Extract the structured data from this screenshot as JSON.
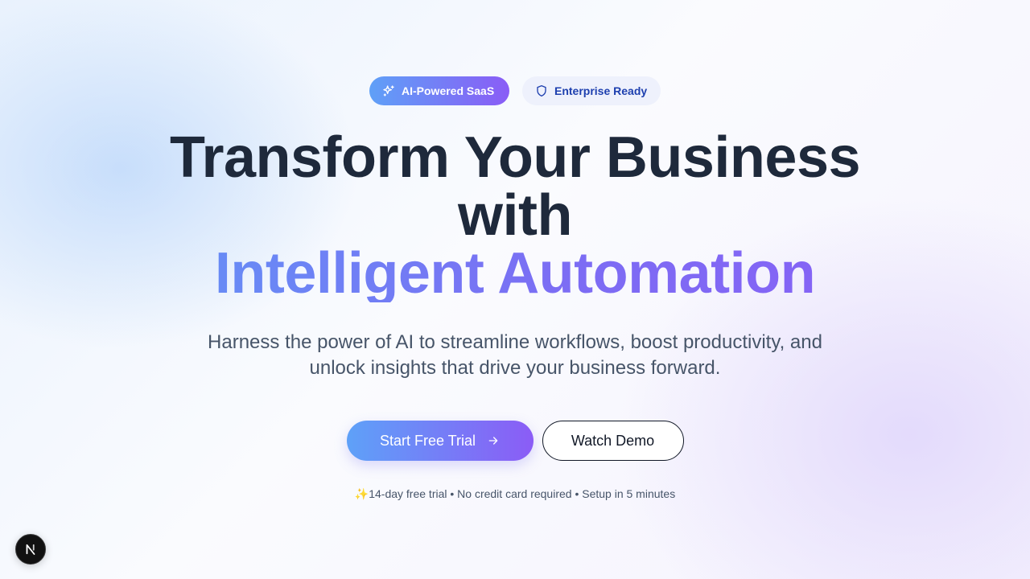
{
  "badges": {
    "ai": {
      "label": "AI-Powered SaaS",
      "icon": "sparkles-icon"
    },
    "enterprise": {
      "label": "Enterprise Ready",
      "icon": "shield-icon"
    }
  },
  "headline": {
    "line1": "Transform Your Business",
    "line2": "with",
    "line3": "Intelligent Automation"
  },
  "subheadline": "Harness the power of AI to streamline workflows, boost productivity, and unlock insights that drive your business forward.",
  "cta": {
    "primary_label": "Start Free Trial",
    "primary_icon": "arrow-right-icon",
    "secondary_label": "Watch Demo"
  },
  "fineprint": "✨14-day free trial • No credit card required • Setup in 5 minutes",
  "dev_indicator": {
    "label": "N",
    "icon": "nextjs-logo-icon"
  },
  "colors": {
    "gradient_start": "#5ea1f8",
    "gradient_end": "#8b5cf6",
    "heading": "#1e293b",
    "body_text": "#475569",
    "enterprise_text": "#1e40af"
  }
}
